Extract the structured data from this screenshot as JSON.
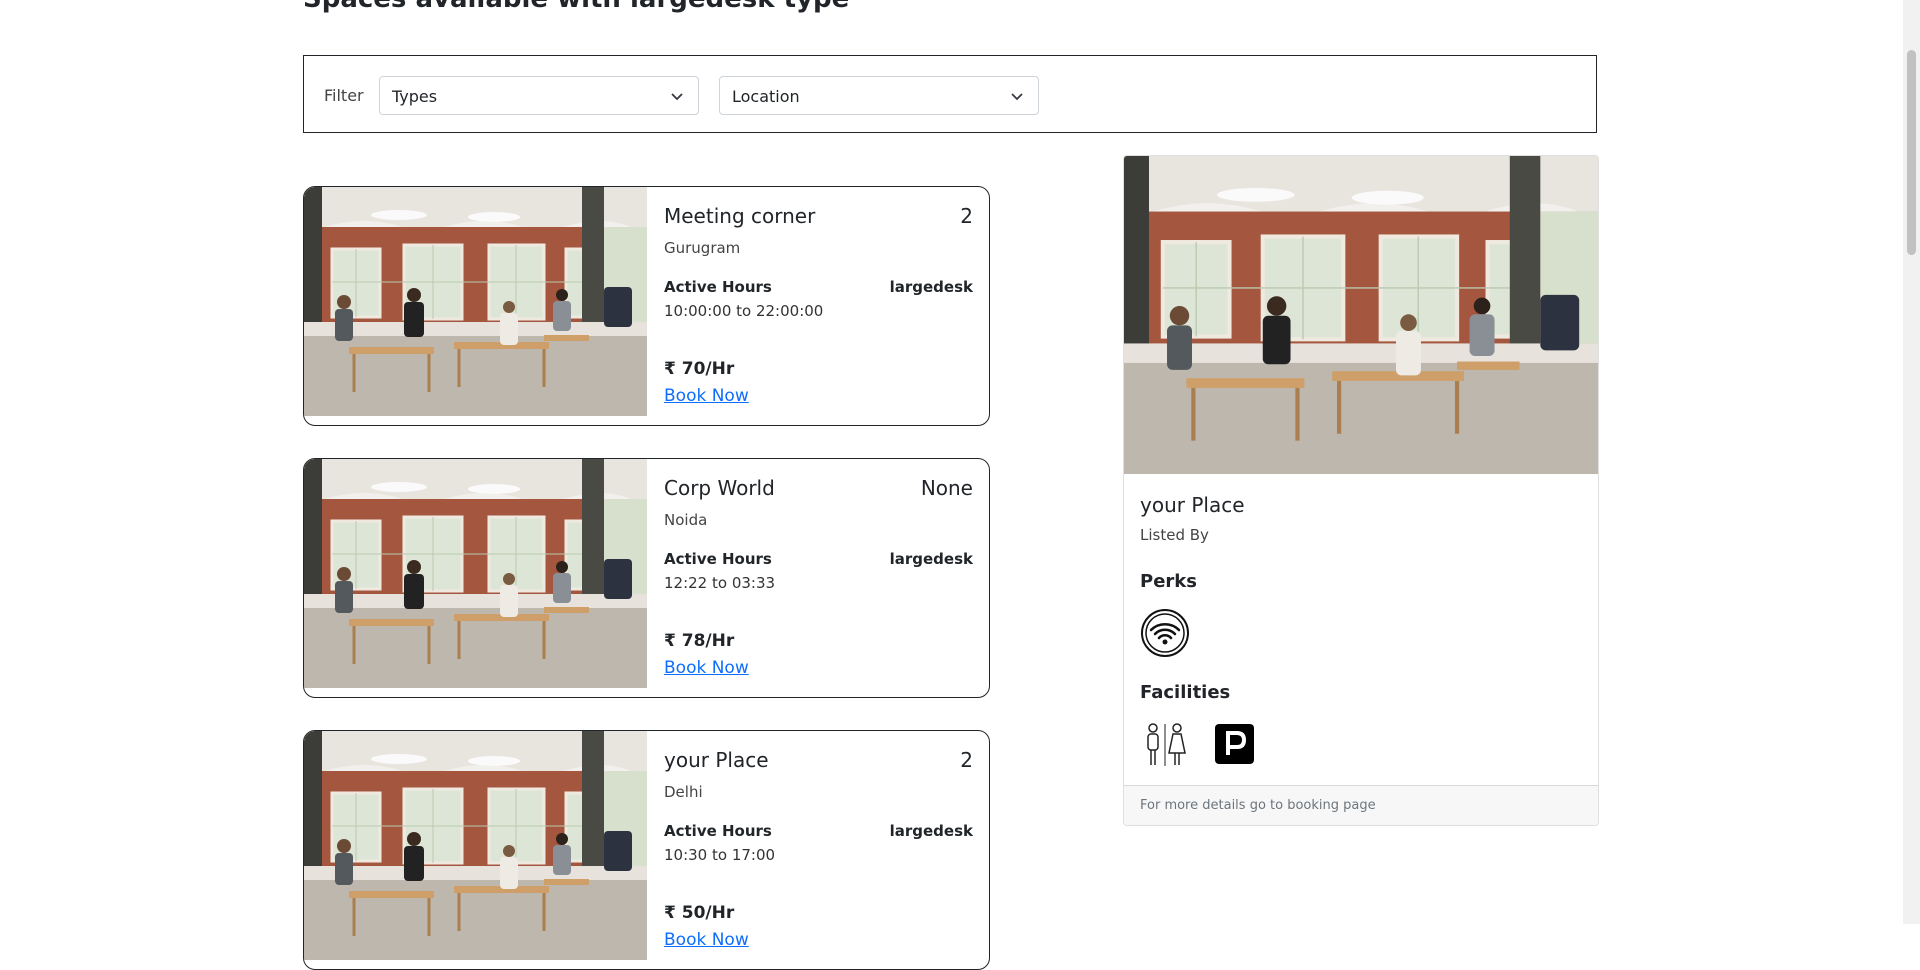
{
  "page": {
    "heading": "Spaces available with largedesk type"
  },
  "filter": {
    "label": "Filter",
    "types_value": "Types",
    "location_value": "Location"
  },
  "cards": [
    {
      "title": "Meeting corner",
      "count": "2",
      "city": "Gurugram",
      "hours_label": "Active Hours",
      "type": "largedesk",
      "hours": "10:00:00 to 22:00:00",
      "price": "₹ 70/Hr",
      "book": "Book Now"
    },
    {
      "title": "Corp World",
      "count": "None",
      "city": "Noida",
      "hours_label": "Active Hours",
      "type": "largedesk",
      "hours": "12:22 to 03:33",
      "price": "₹ 78/Hr",
      "book": "Book Now"
    },
    {
      "title": "your Place",
      "count": "2",
      "city": "Delhi",
      "hours_label": "Active Hours",
      "type": "largedesk",
      "hours": "10:30 to 17:00",
      "price": "₹ 50/Hr",
      "book": "Book Now"
    }
  ],
  "detail": {
    "title": "your Place",
    "listed_by": "Listed By",
    "perks_heading": "Perks",
    "perks_icons": [
      "wifi-icon"
    ],
    "facilities_heading": "Facilities",
    "facilities_icons": [
      "restroom-icon",
      "parking-icon"
    ],
    "footer": "For more details go to booking page"
  },
  "colors": {
    "link": "#0d6efd",
    "border": "#212529",
    "footer_bg": "#f7f7f7"
  }
}
